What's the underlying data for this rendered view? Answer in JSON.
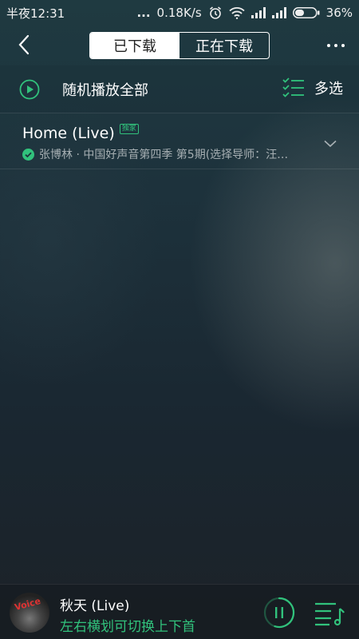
{
  "status_bar": {
    "time": "半夜12:31",
    "dots": "...",
    "speed": "0.18K/s",
    "battery": "36%"
  },
  "header": {
    "tabs": [
      {
        "label": "已下载",
        "active": true
      },
      {
        "label": "正在下载",
        "active": false
      }
    ]
  },
  "action_bar": {
    "play_all_label": "随机播放全部",
    "multi_select_label": "多选"
  },
  "songs": [
    {
      "title": "Home (Live)",
      "badge": "独家",
      "subtitle": "张博林 · 中国好声音第四季 第5期(选择导师：汪…",
      "downloaded": true
    }
  ],
  "player": {
    "title": "秋天 (Live)",
    "hint": "左右横划可切换上下首",
    "cover_text": "Voice",
    "progress": 0.55
  },
  "colors": {
    "accent": "#31c27c"
  }
}
